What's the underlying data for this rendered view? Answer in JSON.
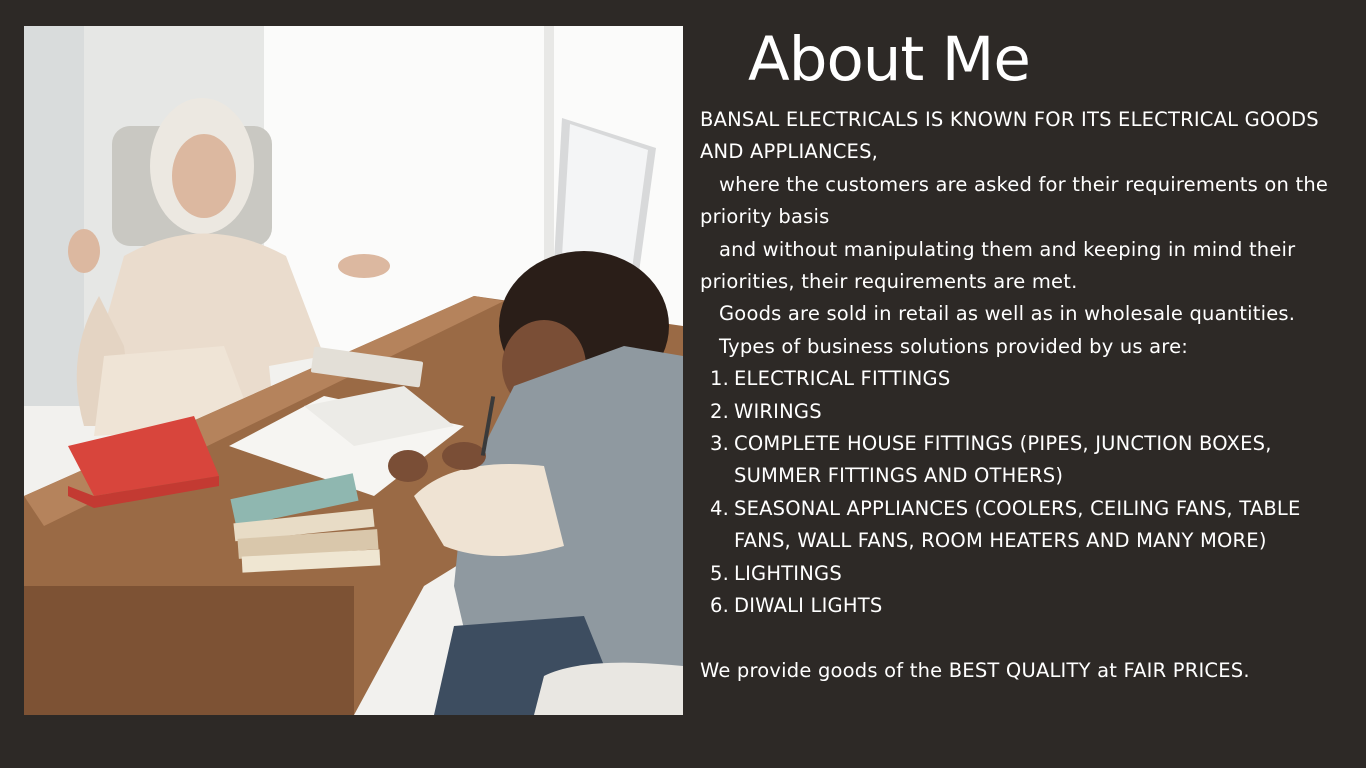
{
  "about": {
    "title": "About Me",
    "intro_line": "BANSAL ELECTRICALS IS KNOWN FOR ITS ELECTRICAL GOODS AND APPLIANCES,",
    "paragraphs": [
      "where the customers are asked for their requirements on the priority basis",
      "and without manipulating them and keeping in mind their priorities, their requirements are met.",
      "Goods are sold in retail as well as in wholesale quantities.",
      "Types of business solutions provided by us are:"
    ],
    "services": [
      {
        "num": "1.",
        "label": "ELECTRICAL FITTINGS"
      },
      {
        "num": "2.",
        "label": "WIRINGS"
      },
      {
        "num": "3.",
        "label": "COMPLETE HOUSE FITTINGS (PIPES, JUNCTION BOXES, SUMMER FITTINGS AND OTHERS)"
      },
      {
        "num": "4.",
        "label": "SEASONAL APPLIANCES (COOLERS, CEILING FANS, TABLE FANS, WALL FANS, ROOM HEATERS AND MANY MORE)"
      },
      {
        "num": "5.",
        "label": "LIGHTINGS"
      },
      {
        "num": "6.",
        "label": "DIWALI LIGHTS"
      }
    ],
    "closing": "We provide goods of the BEST QUALITY at FAIR PRICES."
  },
  "colors": {
    "background": "#2d2926",
    "text": "#ffffff"
  },
  "photo": {
    "subject": "office-meeting-photo"
  }
}
